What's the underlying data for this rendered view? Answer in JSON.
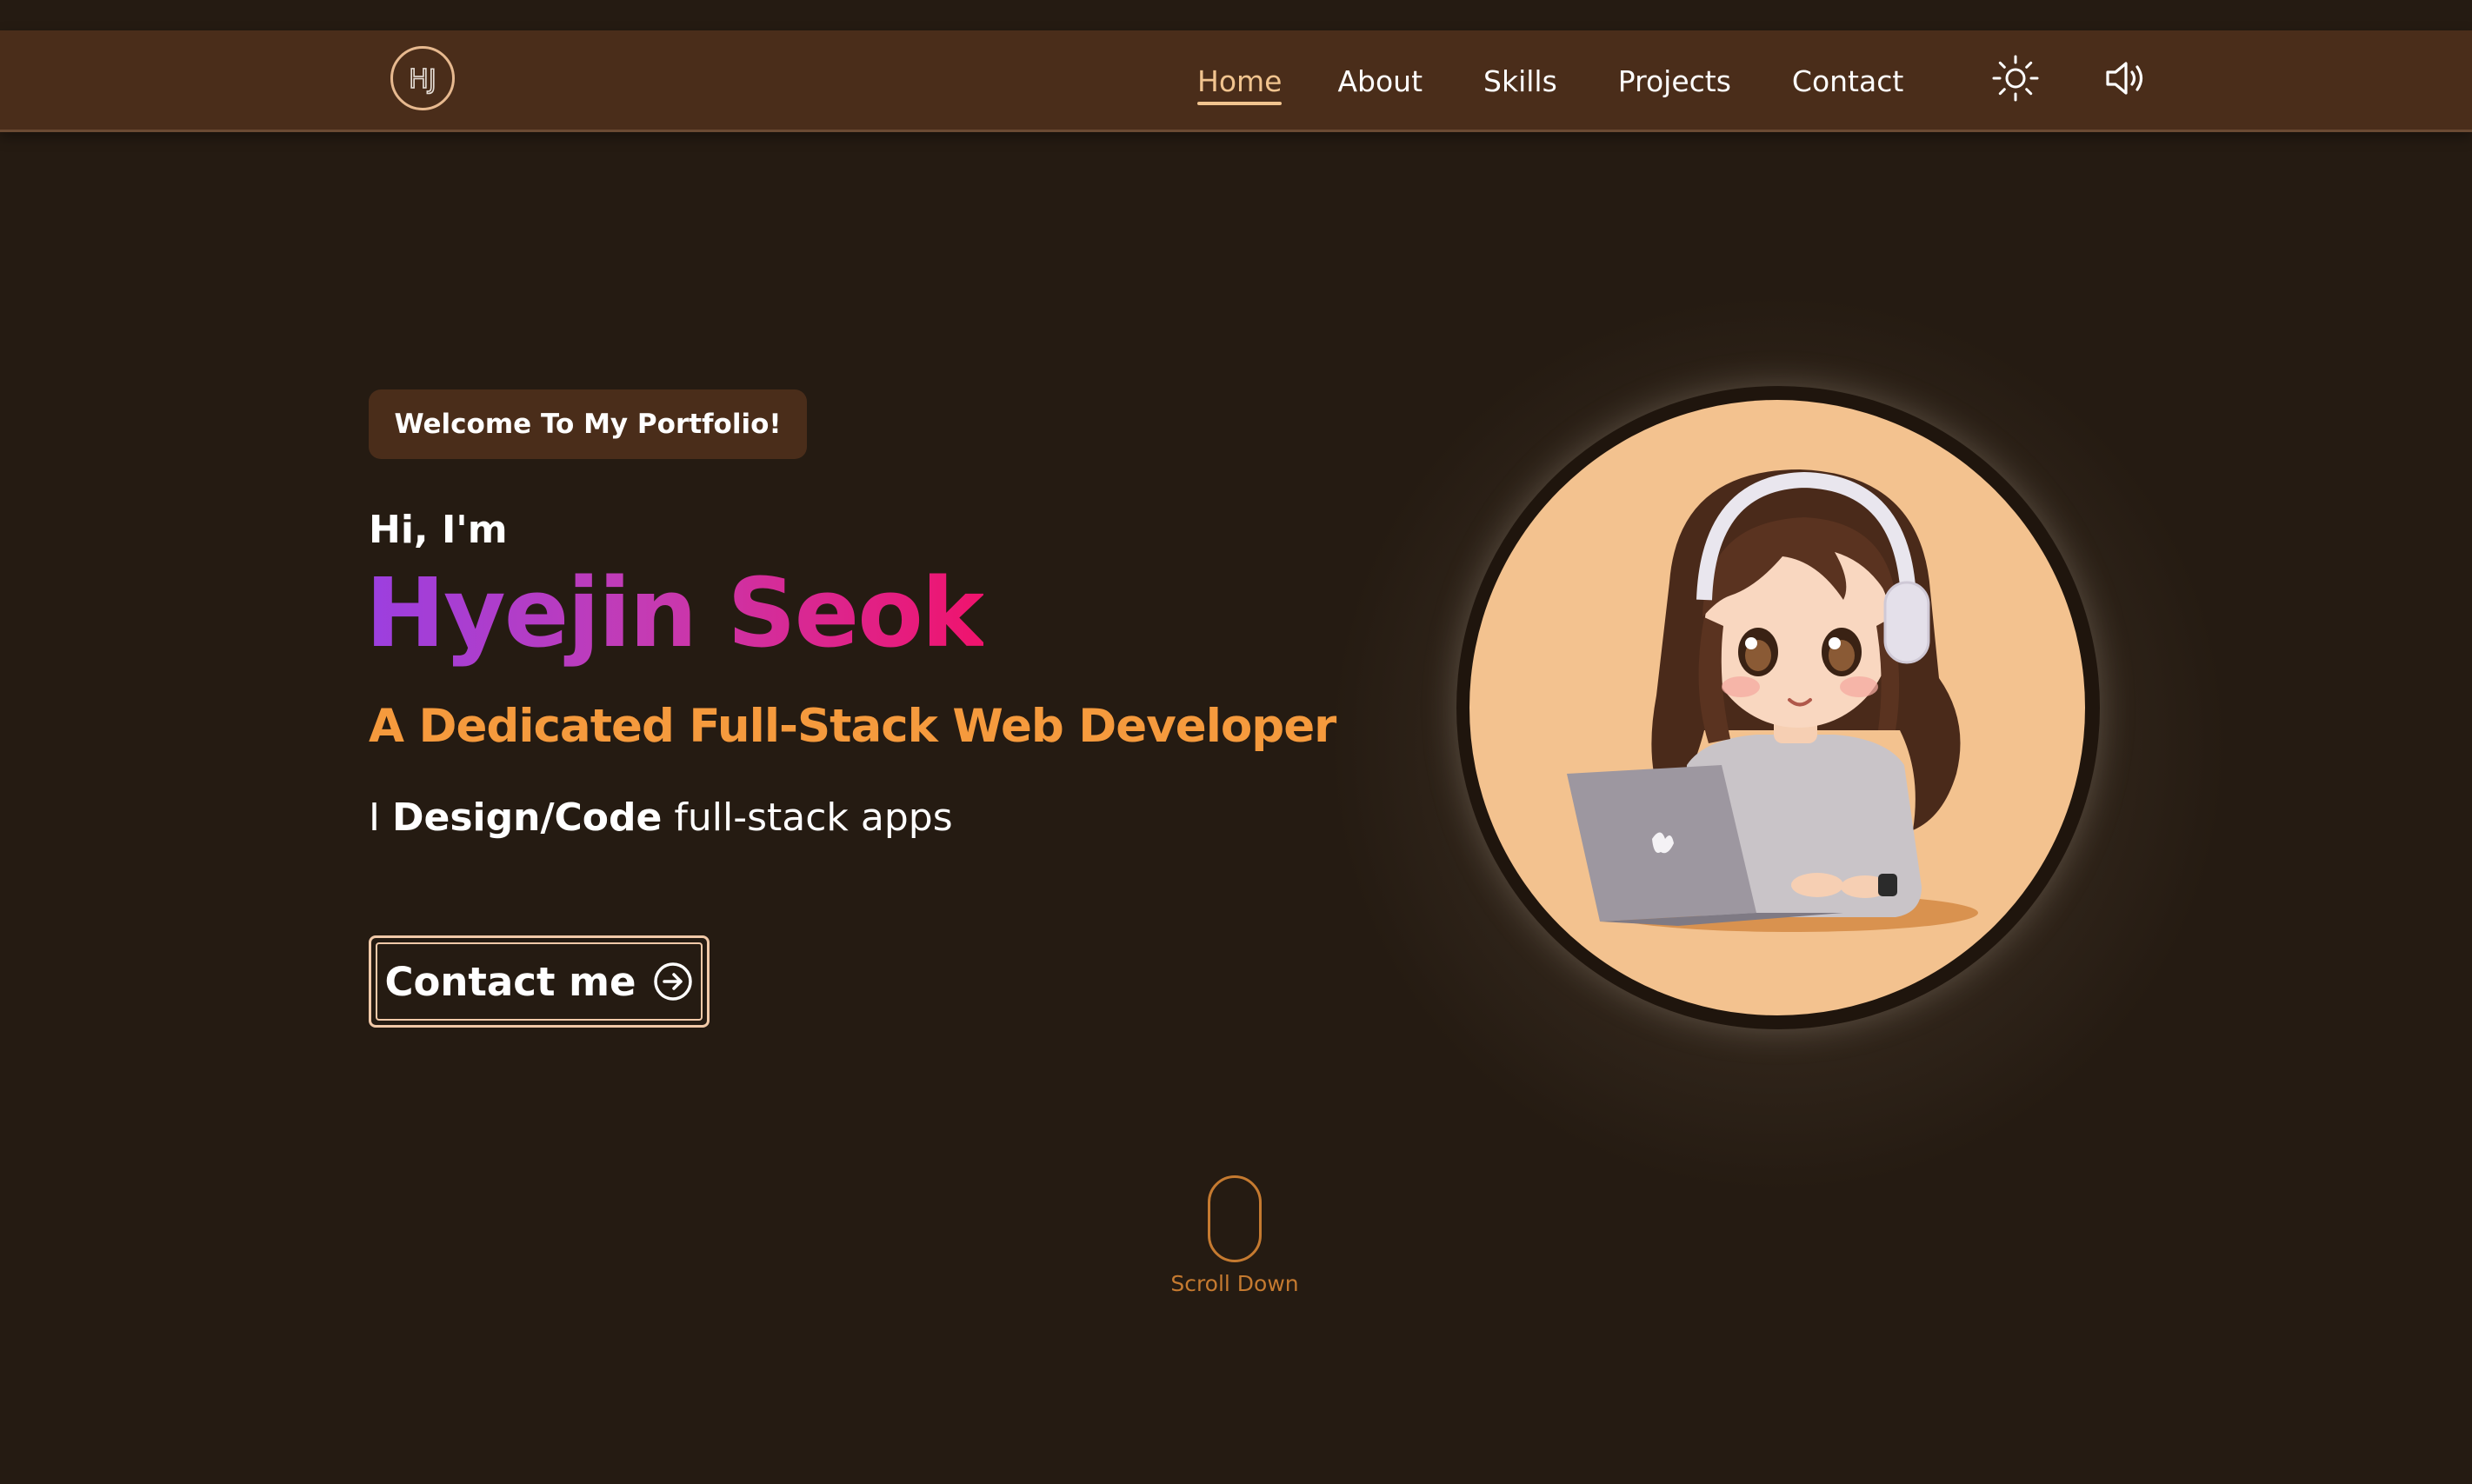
{
  "header": {
    "logo_text": "HJ",
    "nav": {
      "home": "Home",
      "about": "About",
      "skills": "Skills",
      "projects": "Projects",
      "contact": "Contact"
    },
    "active": "Home",
    "theme_icon": "sun-icon",
    "sound_icon": "speaker-icon"
  },
  "hero": {
    "badge": "Welcome To My Portfolio!",
    "greeting": "Hi, I'm",
    "name": "Hyejin Seok",
    "role": "A Dedicated Full-Stack Web Developer",
    "tagline_prefix": "I",
    "tagline_bold": "Design/Code",
    "tagline_suffix": "full-stack apps",
    "cta": "Contact me",
    "cta_icon": "arrow-right-circle-icon"
  },
  "scroll": {
    "label": "Scroll Down"
  },
  "colors": {
    "background": "#251b12",
    "navbar": "#4a2d1a",
    "accent": "#f1c48f",
    "role": "#f59a3d",
    "name_gradient_start": "#9b3fe0",
    "name_gradient_end": "#f0136d",
    "avatar_bg": "#f3c28f"
  }
}
